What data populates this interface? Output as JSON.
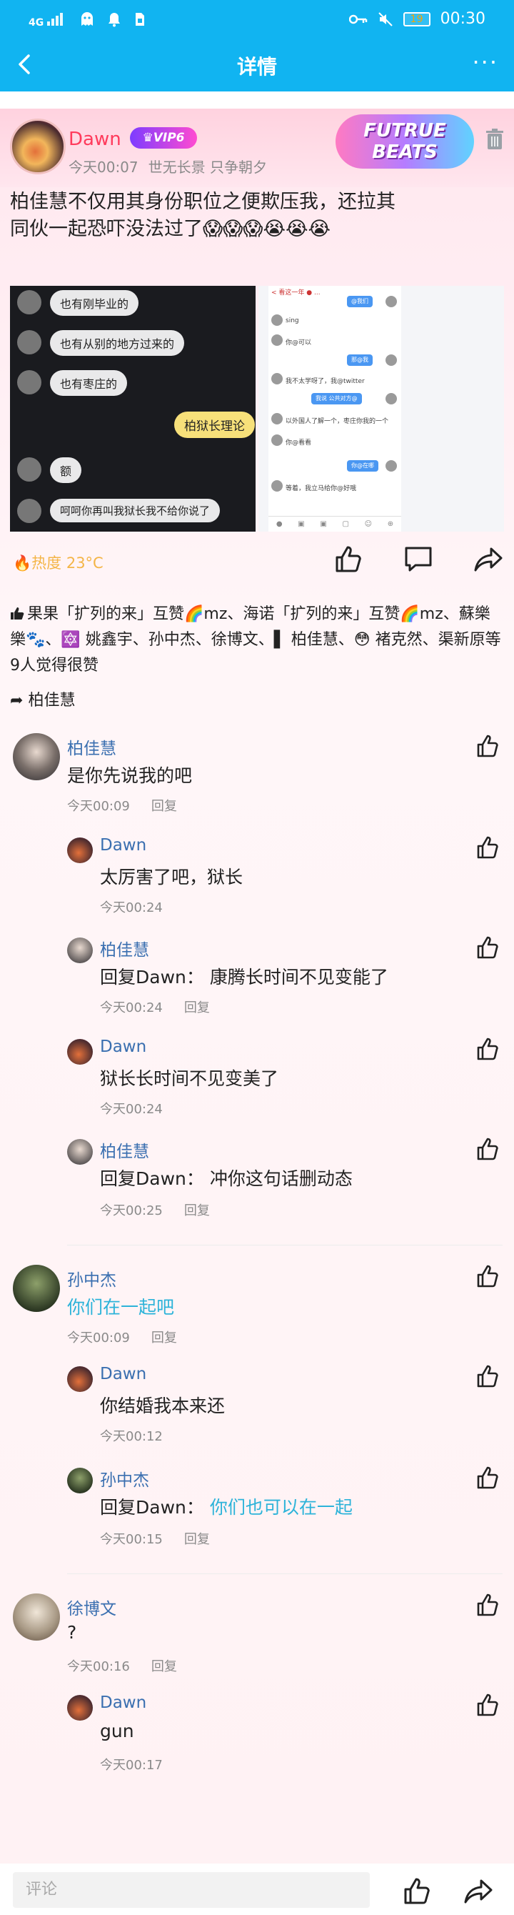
{
  "status_bar": {
    "signal": "4G",
    "time": "00:30",
    "battery": "19"
  },
  "navbar": {
    "title": "详情"
  },
  "post": {
    "author": "Dawn",
    "vip": "VIP6",
    "time": "今天00:07",
    "signature": "世无长景 只争朝夕",
    "badge": "FUTRUE BEATS",
    "text": "柏佳慧不仅用其身份职位之便欺压我，还拉其同伙一起恐吓没法过了😱😱😱😭😭😭",
    "heat": "热度 23°C",
    "likes_text": "果果「扩列的来」互赞🌈mz、海诺「扩列的来」互赞🌈mz、蘇樂樂🐾、🔯 姚鑫宇、孙中杰、徐博文、▌ 柏佳慧、😳 褚克然、渠新原等9人觉得很赞",
    "share_text": "柏佳慧"
  },
  "screenshot1": {
    "bubbles": [
      "也有刚毕业的",
      "也有从别的地方过来的",
      "也有枣庄的",
      "柏狱长理论",
      "额",
      "呵呵你再叫我狱长我不给你说了"
    ]
  },
  "screenshot2": {
    "header": "< 看这一年 ● ...",
    "bubbles": [
      "@我们",
      "sing",
      "你@可以",
      "那@我",
      "我不太学呀了，我@twitter",
      "我说 公共对方@",
      "以外国人了解一个，枣庄你我的一个",
      "你@看看",
      "你@在哪",
      "等着，我立马给你@好哦"
    ]
  },
  "comments": [
    {
      "name": "柏佳慧",
      "text": "是你先说我的吧",
      "text_hl": "",
      "time": "今天00:09",
      "reply": "回复",
      "replies": [
        {
          "name": "Dawn",
          "prefix": "",
          "text": "太厉害了吧，狱长",
          "time": "今天00:24",
          "reply": ""
        },
        {
          "name": "柏佳慧",
          "prefix": "回复Dawn：",
          "text": "康腾长时间不见变能了",
          "time": "今天00:24",
          "reply": "回复"
        },
        {
          "name": "Dawn",
          "prefix": "",
          "text": "狱长长时间不见变美了",
          "time": "今天00:24",
          "reply": ""
        },
        {
          "name": "柏佳慧",
          "prefix": "回复Dawn：",
          "text": "冲你这句话删动态",
          "time": "今天00:25",
          "reply": "回复"
        }
      ]
    },
    {
      "name": "孙中杰",
      "text": "",
      "text_hl": "你们在一起吧",
      "time": "今天00:09",
      "reply": "回复",
      "replies": [
        {
          "name": "Dawn",
          "prefix": "",
          "text": "你结婚我本来还",
          "time": "今天00:12",
          "reply": ""
        },
        {
          "name": "孙中杰",
          "prefix": "回复Dawn：",
          "text_hl": "你们也可以在一起",
          "time": "今天00:15",
          "reply": "回复"
        }
      ]
    },
    {
      "name": "徐博文",
      "text": "?",
      "text_hl": "",
      "time": "今天00:16",
      "reply": "回复",
      "replies": [
        {
          "name": "Dawn",
          "prefix": "",
          "text": "gun",
          "time": "今天00:17",
          "reply": ""
        }
      ]
    }
  ],
  "bottom": {
    "placeholder": "评论"
  },
  "icons": [
    "back-icon",
    "more-icon",
    "trash-icon",
    "like-icon",
    "comment-icon",
    "share-icon",
    "fire-icon"
  ],
  "colors": {
    "primary": "#11b4f1",
    "author": "#ff3b5c",
    "name": "#3a6fb0",
    "highlight": "#2cb3d9",
    "heat": "#f4b547"
  }
}
